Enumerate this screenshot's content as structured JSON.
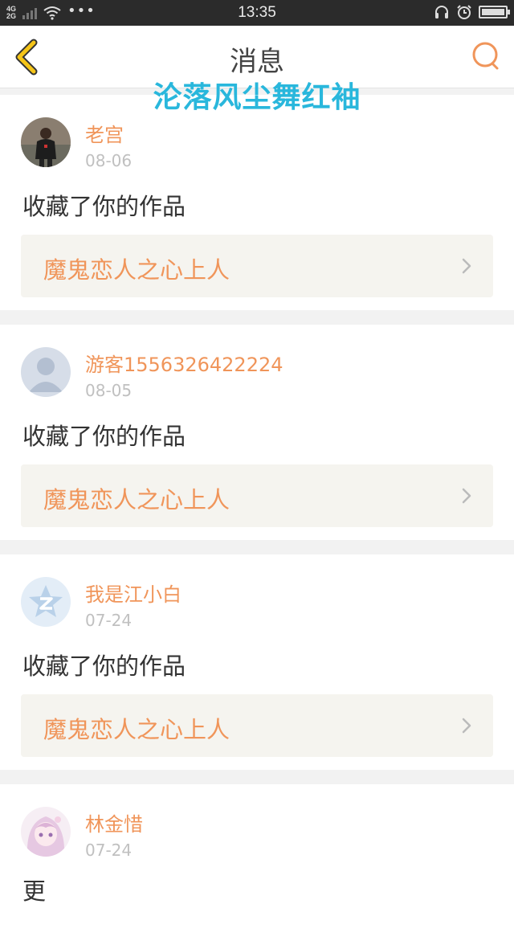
{
  "status_bar": {
    "network_top": "4G",
    "network_bottom": "2G",
    "time": "13:35",
    "icons": [
      "signal-icon",
      "wifi-icon",
      "more-dots-icon",
      "headphones-icon",
      "alarm-icon",
      "battery-icon"
    ],
    "battery_level": 1.0
  },
  "header": {
    "title": "消息",
    "back_icon": "chevron-left-icon",
    "search_icon": "search-icon",
    "accent_color": "#f5c518"
  },
  "watermark": "沦落风尘舞红袖",
  "messages": [
    {
      "username": "老宫",
      "date": "08-06",
      "action": "收藏了你的作品",
      "work_title": "魔鬼恋人之心上人",
      "avatar": "photo-avatar"
    },
    {
      "username": "游客1556326422224",
      "date": "08-05",
      "action": "收藏了你的作品",
      "work_title": "魔鬼恋人之心上人",
      "avatar": "default-user-avatar"
    },
    {
      "username": "我是江小白",
      "date": "07-24",
      "action": "收藏了你的作品",
      "work_title": "魔鬼恋人之心上人",
      "avatar": "qq-avatar"
    },
    {
      "username": "林金惜",
      "date": "07-24",
      "action": "更",
      "avatar": "anime-avatar"
    }
  ],
  "colors": {
    "username": "#f0955a",
    "date": "#c0c0c0",
    "link_background": "#f5f4ef",
    "watermark": "#29b7dc"
  }
}
